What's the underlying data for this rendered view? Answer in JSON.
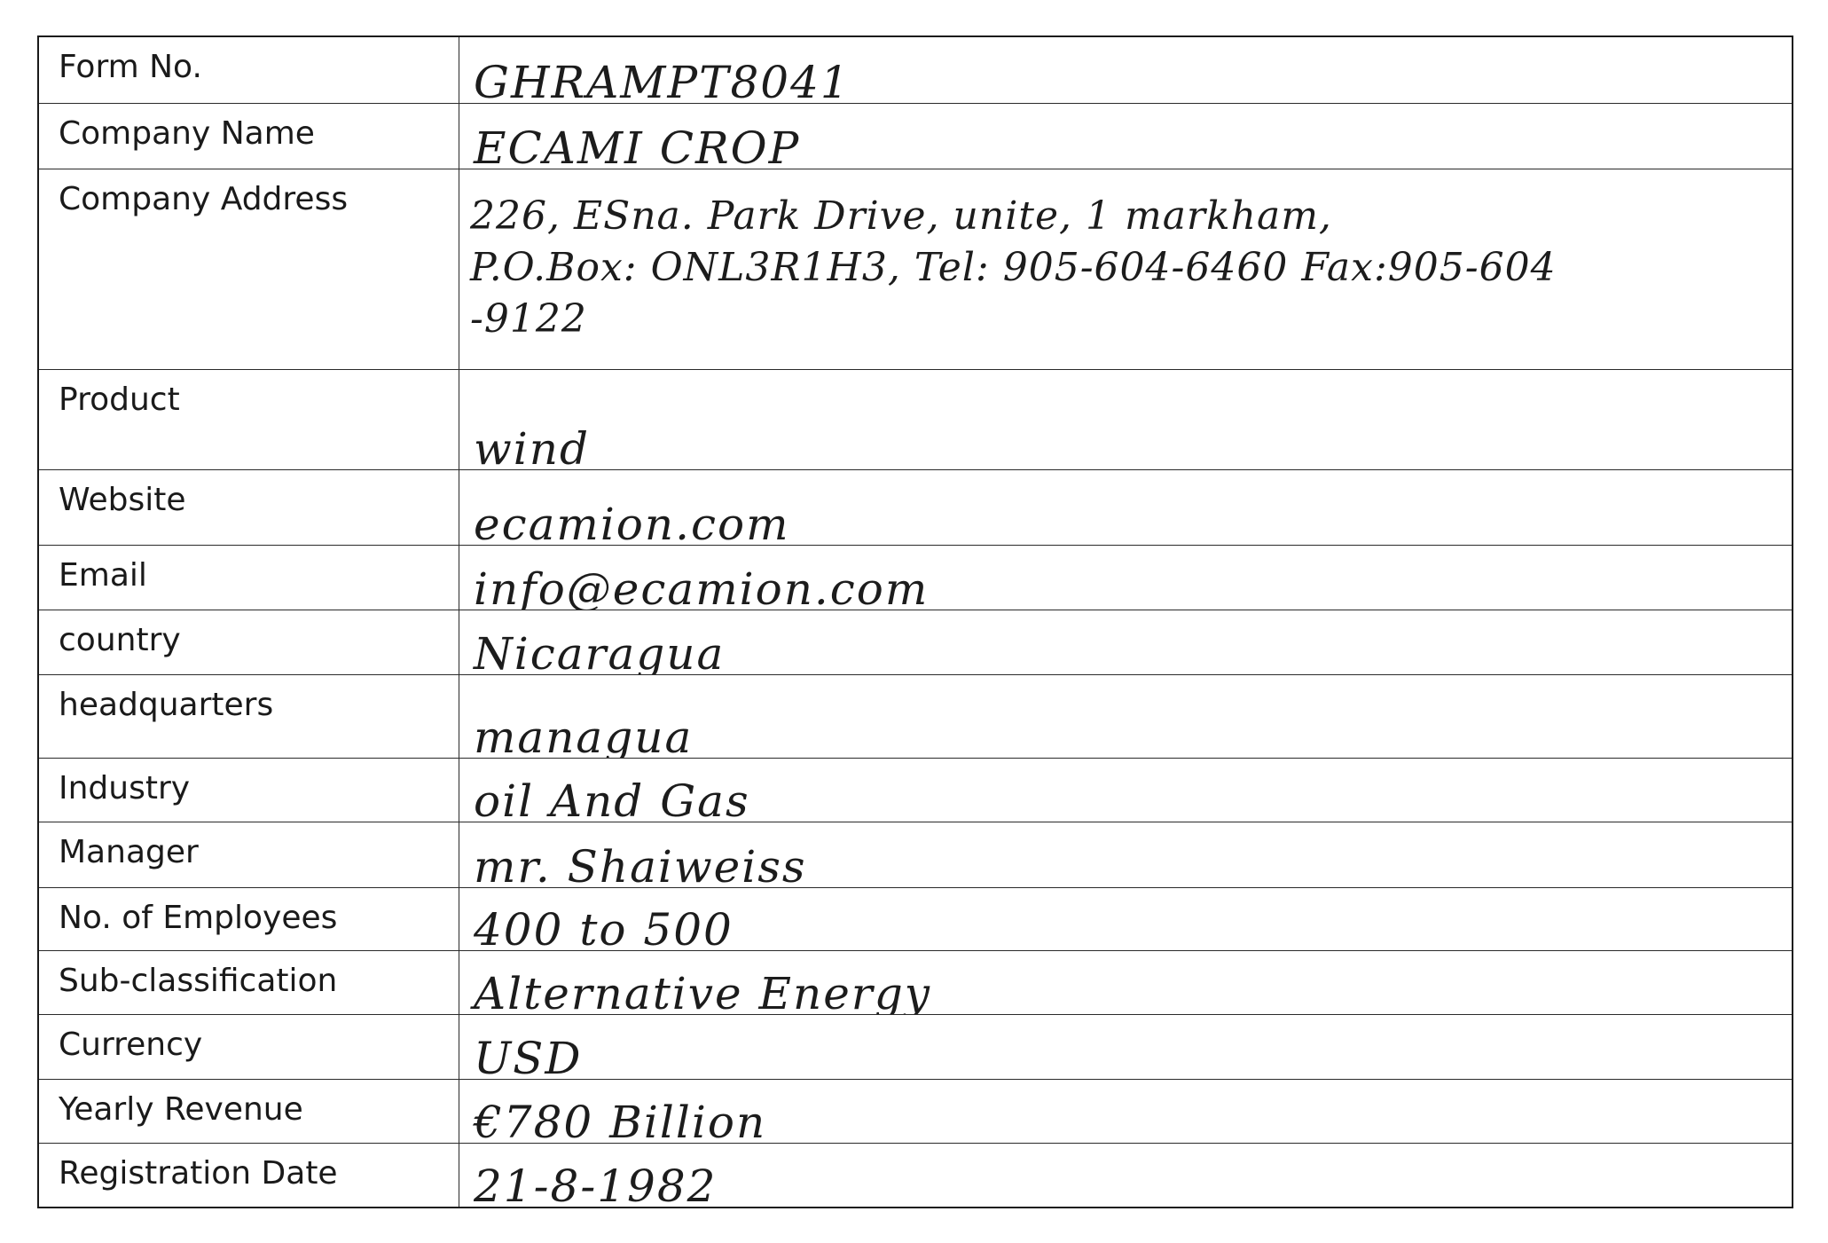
{
  "form": {
    "rows": [
      {
        "label": "Form No.",
        "value": "GHRAMPT8041"
      },
      {
        "label": "Company Name",
        "value": "ECAMI CROP"
      },
      {
        "label": "Company Address",
        "value_lines": [
          "226, ESna. Park Drive, unite, 1 markham,",
          "P.O.Box: ONL3R1H3, Tel: 905-604-6460 Fax:905-604",
          "-9122"
        ]
      },
      {
        "label": "Product",
        "value": "wind"
      },
      {
        "label": "Website",
        "value": "ecamion.com"
      },
      {
        "label": "Email",
        "value": "info@ecamion.com"
      },
      {
        "label": "country",
        "value": "Nicaragua"
      },
      {
        "label": "headquarters",
        "value": "managua"
      },
      {
        "label": "Industry",
        "value": "oil And Gas"
      },
      {
        "label": "Manager",
        "value": "mr. Shaiweiss"
      },
      {
        "label": "No. of Employees",
        "value": "400 to 500"
      },
      {
        "label": "Sub-classification",
        "value": "Alternative Energy"
      },
      {
        "label": "Currency",
        "value": "USD"
      },
      {
        "label": "Yearly Revenue",
        "value": "€780 Billion"
      },
      {
        "label": "Registration Date",
        "value": "21-8-1982"
      }
    ]
  }
}
